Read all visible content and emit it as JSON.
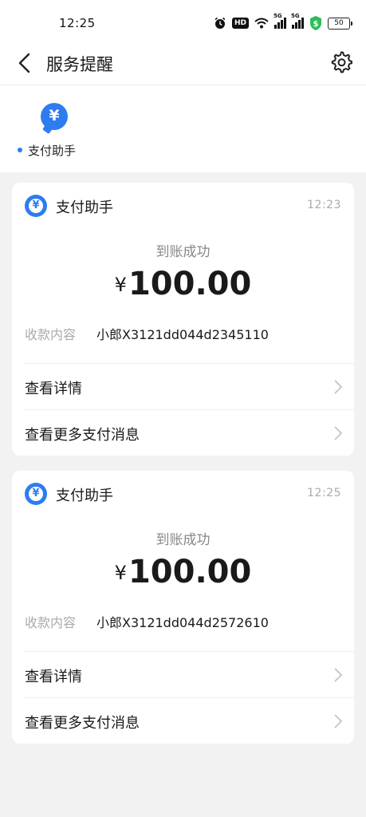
{
  "status_bar": {
    "time": "12:25",
    "hd": "HD",
    "net1": "5G",
    "net2": "5G",
    "battery": "50"
  },
  "nav": {
    "title": "服务提醒"
  },
  "tab": {
    "label": "支付助手",
    "icon_glyph": "¥"
  },
  "cards": [
    {
      "sender": "支付助手",
      "time": "12:23",
      "status": "到账成功",
      "currency": "¥",
      "amount": "100.00",
      "field_label": "收款内容",
      "field_value": "小郎X3121dd044d2345110",
      "link_details": "查看详情",
      "link_more": "查看更多支付消息"
    },
    {
      "sender": "支付助手",
      "time": "12:25",
      "status": "到账成功",
      "currency": "¥",
      "amount": "100.00",
      "field_label": "收款内容",
      "field_value": "小郎X3121dd044d2572610",
      "link_details": "查看详情",
      "link_more": "查看更多支付消息"
    }
  ],
  "colors": {
    "accent": "#2d7cf2",
    "shield_green": "#2ebd59"
  }
}
